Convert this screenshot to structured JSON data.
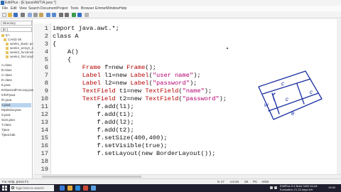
{
  "window": {
    "title": "EditPlus - [E:\\java\\AWT\\A.java *]"
  },
  "menubar": {
    "items": [
      "File",
      "Edit",
      "View",
      "Search",
      "Document",
      "Project",
      "Tools",
      "Browser",
      "Emmet",
      "Window",
      "Help"
    ]
  },
  "sidebar": {
    "directory_tab": "Directory",
    "drive": "[E:]",
    "tree": [
      "E:\\",
      "CAND 08",
      "week1_Basic progr...",
      "week2_arrays_stri...",
      "week3_functions...",
      "week4_find anythin..."
    ],
    "files": [
      "A.class",
      "B.class",
      "C.class",
      "D.class",
      "E.java",
      "EnhancedForLoop.java",
      "Inf1P.java",
      "Ifc.java",
      "A.java",
      "Mydeclar.java",
      "S.java",
      "Sum.java",
      "T.class",
      "Tjava",
      "Tjava.bak"
    ],
    "selected_file_index": 8
  },
  "editor": {
    "tab_label": "A.java",
    "lines": [
      {
        "no": "1",
        "segs": [
          {
            "t": "import java.awt.*;",
            "c": ""
          }
        ]
      },
      {
        "no": "2",
        "segs": [
          {
            "t": "class A",
            "c": ""
          }
        ]
      },
      {
        "no": "3",
        "segs": [
          {
            "t": "{",
            "c": ""
          }
        ]
      },
      {
        "no": "4",
        "segs": [
          {
            "t": "    A()",
            "c": ""
          }
        ]
      },
      {
        "no": "5",
        "segs": [
          {
            "t": "    {",
            "c": ""
          }
        ]
      },
      {
        "no": "6",
        "segs": [
          {
            "t": "        ",
            "c": ""
          },
          {
            "t": "Frame",
            "c": "kw-red"
          },
          {
            "t": " f=new ",
            "c": ""
          },
          {
            "t": "Frame",
            "c": "kw-red"
          },
          {
            "t": "();",
            "c": ""
          }
        ]
      },
      {
        "no": "7",
        "segs": [
          {
            "t": "        ",
            "c": ""
          },
          {
            "t": "Label",
            "c": "kw-red"
          },
          {
            "t": " l1=new ",
            "c": ""
          },
          {
            "t": "Label",
            "c": "kw-red"
          },
          {
            "t": "(",
            "c": ""
          },
          {
            "t": "\"user name\"",
            "c": "str"
          },
          {
            "t": ");",
            "c": ""
          }
        ]
      },
      {
        "no": "8",
        "segs": [
          {
            "t": "        ",
            "c": ""
          },
          {
            "t": "Label",
            "c": "kw-red"
          },
          {
            "t": " l2=new ",
            "c": ""
          },
          {
            "t": "Label",
            "c": "kw-red"
          },
          {
            "t": "(",
            "c": ""
          },
          {
            "t": "\"password\"",
            "c": "str"
          },
          {
            "t": ");",
            "c": ""
          }
        ]
      },
      {
        "no": "9",
        "segs": [
          {
            "t": "        ",
            "c": ""
          },
          {
            "t": "TextField",
            "c": "kw-red"
          },
          {
            "t": " t1=new ",
            "c": ""
          },
          {
            "t": "TextField",
            "c": "kw-red"
          },
          {
            "t": "(",
            "c": ""
          },
          {
            "t": "\"name\"",
            "c": "str"
          },
          {
            "t": ");",
            "c": ""
          }
        ]
      },
      {
        "no": "10",
        "segs": [
          {
            "t": "        ",
            "c": ""
          },
          {
            "t": "TextField",
            "c": "kw-red"
          },
          {
            "t": " t2=new ",
            "c": ""
          },
          {
            "t": "TextField",
            "c": "kw-red"
          },
          {
            "t": "(",
            "c": ""
          },
          {
            "t": "\"password\"",
            "c": "str"
          },
          {
            "t": ");",
            "c": ""
          }
        ]
      },
      {
        "no": "11",
        "segs": [
          {
            "t": "            f.add(l1);",
            "c": ""
          }
        ]
      },
      {
        "no": "12",
        "segs": [
          {
            "t": "            f.add(t1);",
            "c": ""
          }
        ]
      },
      {
        "no": "13",
        "segs": [
          {
            "t": "            f.add(l2);",
            "c": ""
          }
        ]
      },
      {
        "no": "14",
        "segs": [
          {
            "t": "            f.add(t2);",
            "c": ""
          }
        ]
      },
      {
        "no": "15",
        "segs": [
          {
            "t": "            f.setSize(400,400);",
            "c": ""
          }
        ]
      },
      {
        "no": "16",
        "segs": [
          {
            "t": "            f.setVisible(true);",
            "c": ""
          }
        ]
      },
      {
        "no": "17",
        "segs": [
          {
            "t": "            f.setLayout(new BorderLayout());",
            "c": ""
          }
        ]
      },
      {
        "no": "18",
        "segs": [
          {
            "t": "",
            "c": ""
          }
        ]
      },
      {
        "no": "19",
        "segs": [
          {
            "t": "",
            "c": ""
          }
        ]
      }
    ]
  },
  "statusbar": {
    "help": "For Help, press F1",
    "ln": "ln 17",
    "col": "col 45",
    "lines": "28",
    "mode": "PC",
    "encoding": "ANSI"
  },
  "taskbar": {
    "search_placeholder": "Type here to search",
    "tray_line1": "EditPlus 5.4 Build 3400 64-bit",
    "tray_line2": "Evaluation 21.23 days left",
    "clock": "19:40"
  },
  "sketch": {
    "cells": [
      "c",
      "c",
      "c",
      "w",
      "e"
    ],
    "color": "#1a2fa0"
  },
  "colors": {
    "keyword": "#b40000",
    "string": "#b4006e",
    "selection": "#b9d4ee"
  }
}
